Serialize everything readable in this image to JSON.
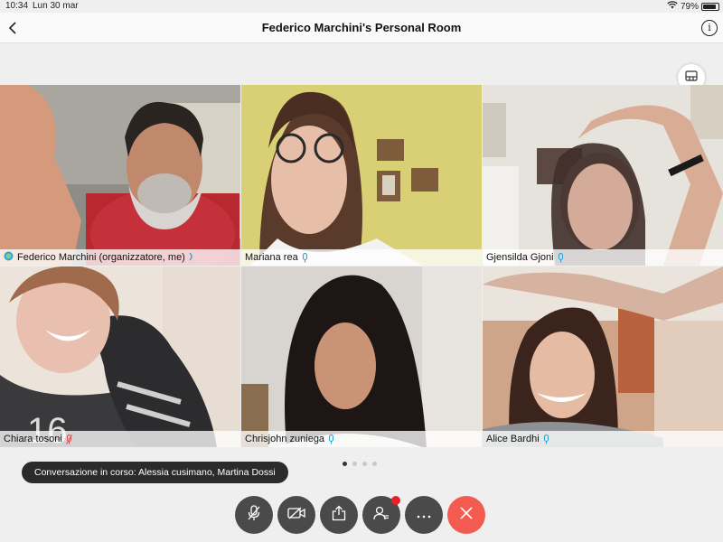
{
  "status_bar": {
    "time": "10:34",
    "date": "Lun 30 mar",
    "battery": "79%",
    "battery_level": 0.79
  },
  "header": {
    "title": "Federico Marchini's Personal Room"
  },
  "participants": [
    {
      "name": "Federico Marchini (organizzatore, me)",
      "mic": "speaking",
      "active": true
    },
    {
      "name": "Mariana rea",
      "mic": "on"
    },
    {
      "name": "Gjensilda Gjoni",
      "mic": "on"
    },
    {
      "name": "Chiara tosoni",
      "mic": "muted"
    },
    {
      "name": "Chrisjohn zuniega",
      "mic": "on"
    },
    {
      "name": "Alice Bardhi",
      "mic": "on"
    }
  ],
  "pager": {
    "pages": 4,
    "current": 1
  },
  "toast": {
    "text": "Conversazione in corso: Alessia cusimano, Martina Dossi"
  },
  "controls": [
    "mute-mic",
    "stop-video",
    "share",
    "participants",
    "more",
    "end-call"
  ],
  "colors": {
    "end_call": "#f35a50",
    "control_bg": "#4a4a4a",
    "active_border": "#2ea3d4",
    "badge": "#e8202a",
    "mic_on": "#2ea3d4",
    "mic_muted": "#e05050"
  }
}
